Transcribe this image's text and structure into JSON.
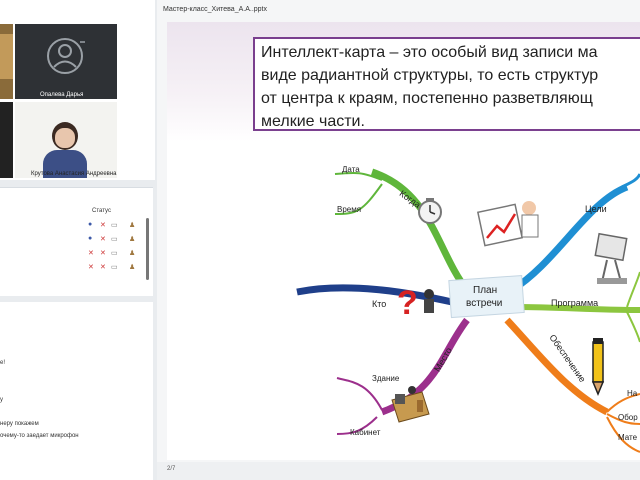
{
  "document": {
    "title": "Мастер-класс_Хитева_А.А..pptx",
    "page_indicator": "2/7"
  },
  "video_tiles": [
    {
      "name": "Опалева Дарья",
      "avatar_icon": "person-icon"
    },
    {
      "name": "Крутова Анастасия Андреевна"
    }
  ],
  "participants": {
    "status_header": "Статус"
  },
  "chat": {
    "lines": [
      "е!",
      "у",
      "неру покажем",
      "очему-то заедает микрофон"
    ]
  },
  "slide": {
    "definition_lines": [
      "Интеллект-карта – это особый вид записи ма",
      "виде радиантной структуры, то есть структур",
      "от центра к краям, постепенно разветвляющ",
      "мелкие части."
    ],
    "mindmap": {
      "center_label_1": "План",
      "center_label_2": "встречи",
      "when": "Когда",
      "date": "Дата",
      "time": "Время",
      "who": "Кто",
      "place": "Место",
      "building": "Здание",
      "office": "Кабинет",
      "goals": "Цели",
      "program": "Программа",
      "provision": "Обеспечение",
      "sub_na": "На",
      "sub_obor": "Обор",
      "sub_mate": "Мате"
    }
  },
  "colors": {
    "frame_purple": "#7a3f8e",
    "green": "#5fb63b",
    "blue": "#1f8fd3",
    "purple": "#9c2f8c",
    "orange": "#ef7d1a",
    "lime": "#8cc63f"
  }
}
